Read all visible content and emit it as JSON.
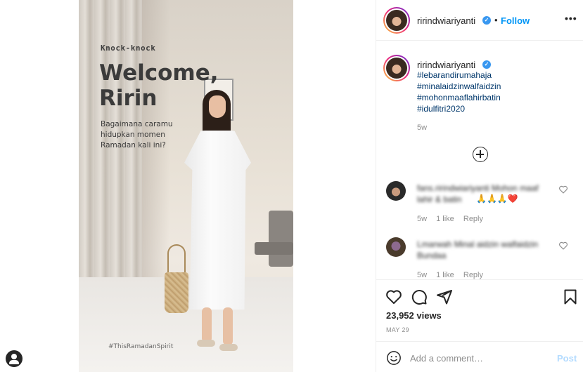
{
  "video": {
    "overlay_knock": "Knock-knock",
    "overlay_title": "Welcome,\nRirin",
    "overlay_question": "Bagaimana caramu\nhidupkan momen\nRamadan kali ini?",
    "overlay_hashtag": "#ThisRamadanSpirit"
  },
  "header": {
    "username": "ririndwiariyanti",
    "separator": "•",
    "follow_label": "Follow",
    "more_label": "•••"
  },
  "caption": {
    "username": "ririndwiariyanti",
    "hashtags": [
      "#lebarandirumahaja",
      "#minalaidzinwalfaidzin",
      "#mohonmaaflahirbatin",
      "#idulfitri2020"
    ],
    "time": "5w"
  },
  "comments": [
    {
      "text": "fans.ririndwiariyanti Mohon maaf lahir & batin",
      "emoji": "🙏🙏🙏❤️",
      "time": "5w",
      "likes": "1 like",
      "reply_label": "Reply"
    },
    {
      "text": "Lmarwah Minal aidzin walfaidzin Bundaa",
      "emoji": "",
      "time": "5w",
      "likes": "1 like",
      "reply_label": "Reply"
    }
  ],
  "stats": {
    "views": "23,952 views",
    "date": "MAY 29"
  },
  "comment_box": {
    "placeholder": "Add a comment…",
    "post_label": "Post"
  },
  "icons": {
    "like": "heart-icon",
    "comment": "comment-icon",
    "share": "share-icon",
    "save": "bookmark-icon",
    "emoji": "emoji-icon",
    "load_more": "plus-circle-icon",
    "verified": "verified-badge-icon"
  },
  "colors": {
    "link": "#00376b",
    "follow": "#0095f6",
    "verified": "#3897f0",
    "post_disabled": "#b3dbff",
    "muted": "#8e8e8e"
  }
}
